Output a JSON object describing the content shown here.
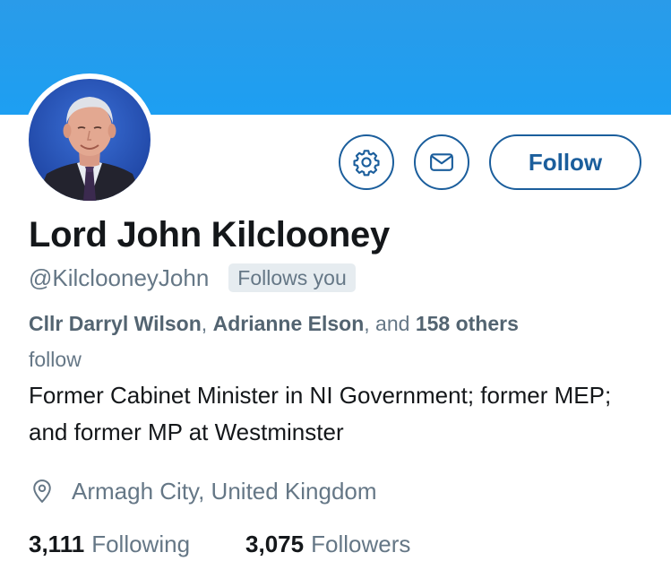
{
  "profile": {
    "display_name": "Lord John Kilclooney",
    "handle": "@KilclooneyJohn",
    "follows_you_badge": "Follows you",
    "bio": "Former Cabinet Minister in NI Government; former MEP; and former MP at Westminster",
    "location": "Armagh City, United Kingdom"
  },
  "actions": {
    "settings_icon": "gear-icon",
    "message_icon": "envelope-icon",
    "follow_label": "Follow"
  },
  "followed_by": {
    "names": [
      "Cllr Darryl Wilson",
      "Adrianne Elson"
    ],
    "separator": ", ",
    "conjunction": ", and ",
    "others_count": "158",
    "others_word": "others",
    "suffix": "follow"
  },
  "stats": {
    "following_count": "3,111",
    "following_label": "Following",
    "followers_count": "3,075",
    "followers_label": "Followers"
  },
  "colors": {
    "banner": "#1d9ff2",
    "accent": "#1b5e9c",
    "muted_text": "#657786",
    "primary_text": "#14171a",
    "badge_bg": "#e6ecf0"
  }
}
